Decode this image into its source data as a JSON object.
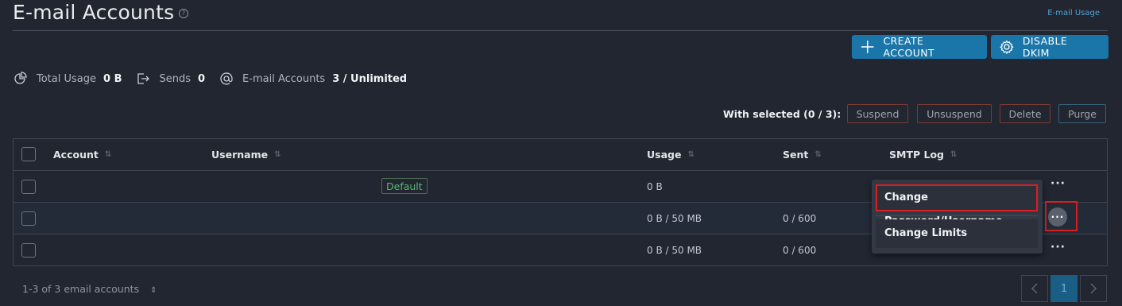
{
  "header": {
    "title": "E-mail Accounts",
    "help_glyph": "?",
    "usage_link": "E-mail Usage"
  },
  "toolbar": {
    "create_label": "CREATE ACCOUNT",
    "disable_dkim_label": "DISABLE DKIM"
  },
  "stats": {
    "total_usage_label": "Total Usage",
    "total_usage_value": "0 B",
    "sends_label": "Sends",
    "sends_value": "0",
    "accounts_label": "E-mail Accounts",
    "accounts_value": "3 / Unlimited"
  },
  "bulk": {
    "label": "With selected (0 / 3):",
    "suspend": "Suspend",
    "unsuspend": "Unsuspend",
    "delete": "Delete",
    "purge": "Purge"
  },
  "table": {
    "columns": [
      "Account",
      "Username",
      "Usage",
      "Sent",
      "SMTP Log"
    ],
    "rows": [
      {
        "badge": "Default",
        "usage": "0 B",
        "sent": ""
      },
      {
        "badge": "",
        "usage": "0 B / 50 MB",
        "sent": "0 / 600"
      },
      {
        "badge": "",
        "usage": "0 B / 50 MB",
        "sent": "0 / 600"
      }
    ]
  },
  "row_menu": {
    "items": [
      "Change Password/Username",
      "Change Limits"
    ]
  },
  "footer": {
    "summary": "1-3 of 3 email accounts",
    "sort_glyph": "⇕",
    "page_current": "1"
  },
  "colors": {
    "background": "#222630",
    "accent": "#1a76a8",
    "default_badge": "#58b877",
    "highlight": "#d81f1f"
  }
}
